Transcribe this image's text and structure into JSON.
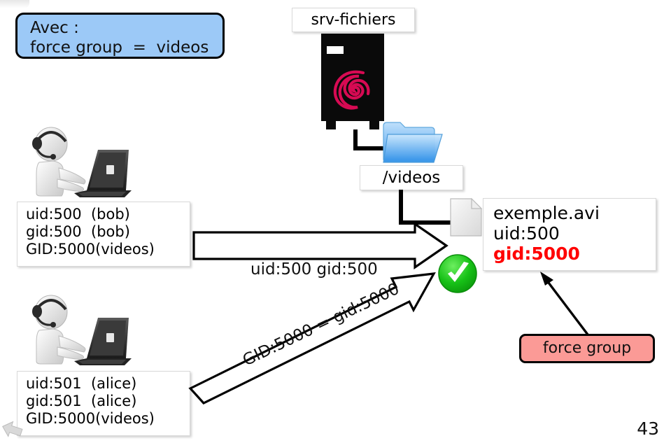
{
  "slide": {
    "page_number": "43",
    "background_color": "#ffffff"
  },
  "avec_box": {
    "line1": "Avec :",
    "line2": "force group  =  videos",
    "fill_color": "#9CC9F7",
    "border_color": "#000000"
  },
  "server": {
    "label": "srv-fichiers",
    "os_icon": "debian-swirl-icon",
    "body_color": "#0a0a0a",
    "swirl_color": "#D70A53"
  },
  "folder": {
    "label": "/videos",
    "icon": "folder-icon",
    "color": "#4BA3F5"
  },
  "file": {
    "icon": "document-icon",
    "name": "exemple.avi",
    "uid": "uid:500",
    "gid": "gid:5000",
    "gid_color": "#FF0000"
  },
  "status": {
    "icon": "green-check-icon",
    "color": "#17C117"
  },
  "users": [
    {
      "id": "bob",
      "avatar": "user-laptop-icon",
      "uid": "uid:500  (bob)",
      "gid": "gid:500  (bob)",
      "group": "GID:5000(videos)"
    },
    {
      "id": "alice",
      "avatar": "user-laptop-icon",
      "uid": "uid:501  (alice)",
      "gid": "gid:501  (alice)",
      "group": "GID:5000(videos)"
    }
  ],
  "arrows": {
    "horizontal_label": "uid:500 gid:500",
    "diagonal_label": "GID:5000 = gid:5000"
  },
  "force_badge": {
    "label": "force group",
    "fill_color": "#FB9A96",
    "border_color": "#000000"
  },
  "corner": {
    "nav_icon": "back-arrow-icon"
  }
}
